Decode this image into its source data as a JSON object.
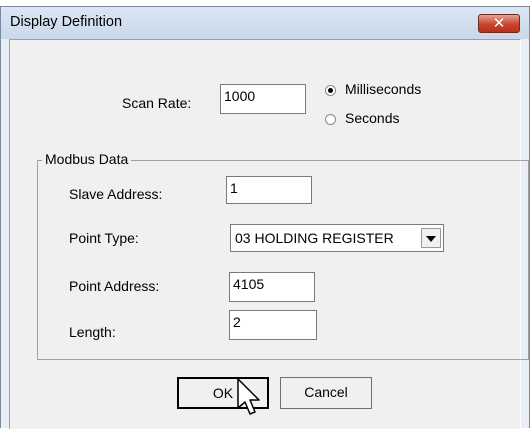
{
  "window": {
    "title": "Display Definition"
  },
  "scan": {
    "label": "Scan Rate:",
    "value": "1000",
    "options": [
      {
        "label": "Milliseconds",
        "selected": true
      },
      {
        "label": "Seconds",
        "selected": false
      }
    ]
  },
  "modbus": {
    "group_title": "Modbus Data",
    "slave_address": {
      "label": "Slave Address:",
      "value": "1"
    },
    "point_type": {
      "label": "Point Type:",
      "value": "03 HOLDING REGISTER"
    },
    "point_address": {
      "label": "Point Address:",
      "value": "4105"
    },
    "length": {
      "label": "Length:",
      "value": "2"
    }
  },
  "buttons": {
    "ok": "OK",
    "cancel": "Cancel"
  },
  "icons": {
    "close": "close-icon",
    "radio": "radio-icon",
    "dropdown": "chevron-down-icon",
    "cursor": "mouse-pointer-icon"
  },
  "colors": {
    "close_button": "#c9442f",
    "titlebar": "#c9d8ea",
    "dialog_bg": "#f0f0f0"
  }
}
